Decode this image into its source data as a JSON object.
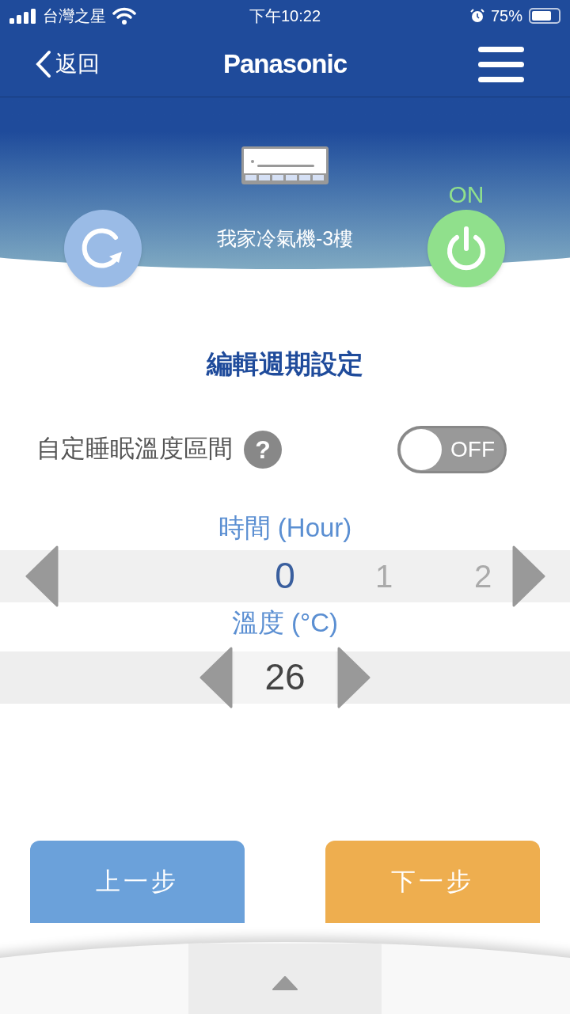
{
  "status_bar": {
    "carrier": "台灣之星",
    "time": "下午10:22",
    "battery": "75%"
  },
  "nav": {
    "back": "返回",
    "brand": "Panasonic"
  },
  "device": {
    "name": "我家冷氣機-3樓",
    "power_label": "ON",
    "power_on": true
  },
  "page_title": "編輯週期設定",
  "sleep_range": {
    "label": "自定睡眠溫度區間",
    "help": "?",
    "on": false,
    "state_text": "OFF"
  },
  "hour_picker": {
    "label": "時間 (Hour)",
    "items": [
      {
        "value": "0",
        "selected": true
      },
      {
        "value": "1",
        "selected": false
      },
      {
        "value": "2",
        "selected": false
      }
    ]
  },
  "temp_picker": {
    "label": "溫度 (°C)",
    "value": "26"
  },
  "buttons": [
    {
      "kind": "back",
      "label": "上一步"
    },
    {
      "kind": "next",
      "label": "下一步"
    }
  ]
}
